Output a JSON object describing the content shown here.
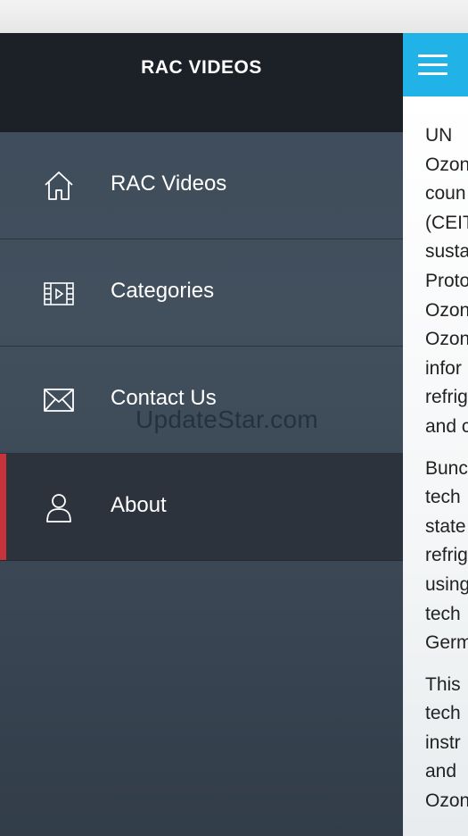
{
  "drawer": {
    "title": "RAC VIDEOS",
    "items": [
      {
        "label": "RAC Videos",
        "icon": "home-icon",
        "active": false
      },
      {
        "label": "Categories",
        "icon": "film-icon",
        "active": false
      },
      {
        "label": "Contact Us",
        "icon": "envelope-icon",
        "active": false
      },
      {
        "label": "About",
        "icon": "user-icon",
        "active": true
      }
    ]
  },
  "content": {
    "paragraphs": [
      "UN\nOzon\ncoun\n(CEIT\nsusta\nProto\nOzon\nOzon\ninfor\nrefrig\nand c",
      "Bunc\ntech\nstate\nrefrig\nusing\ntech\nGerm",
      "This\ntech\ninstr\nand\nOzon"
    ]
  },
  "watermark": "UpdateStar.com",
  "colors": {
    "accent": "#21b2e8",
    "active_indicator": "#c8323a",
    "drawer_header": "#1c2128"
  }
}
